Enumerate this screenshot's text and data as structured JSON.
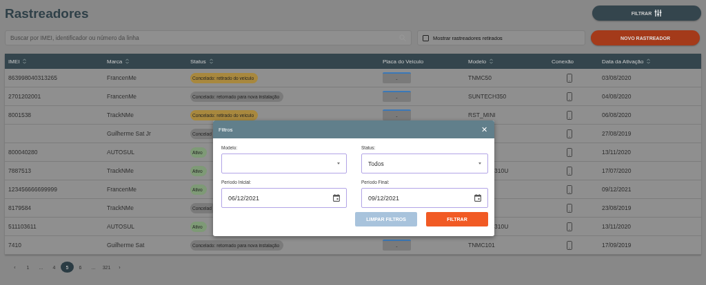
{
  "page": {
    "title": "Rastreadores"
  },
  "filter_button": {
    "label": "FILTRAR"
  },
  "search": {
    "placeholder": "Buscar por IMEI, identificador ou número da linha"
  },
  "show_retired": {
    "label": "Mostrar rastreadores retirados",
    "checked": false
  },
  "new_button": {
    "label": "NOVO RASTREADOR"
  },
  "table": {
    "columns": [
      {
        "label": "IMEI",
        "sortable": true
      },
      {
        "label": "Marca",
        "sortable": true
      },
      {
        "label": "Status",
        "sortable": true
      },
      {
        "label": "Placa do Veiculo",
        "sortable": false
      },
      {
        "label": "Modelo",
        "sortable": true
      },
      {
        "label": "Conexão",
        "sortable": false
      },
      {
        "label": "Data da Ativação",
        "sortable": true
      }
    ],
    "rows": [
      {
        "imei": "863998040313265",
        "marca": "FrancenMe",
        "status": {
          "text": "Concelado: retirado do veiculo",
          "color": "#a8883e"
        },
        "placa": "-",
        "modelo": {
          "text": "TNMC50"
        },
        "data": "03/08/2020"
      },
      {
        "imei": "2701202001",
        "marca": "FrancenMe",
        "status": {
          "text": "Concelado: retornado para nova instalação",
          "color": "#7a7a7a"
        },
        "placa": "-",
        "modelo": {
          "text": "SUNTECH350"
        },
        "data": "04/08/2020"
      },
      {
        "imei": "8001538",
        "marca": "TrackNMe",
        "status": {
          "text": "Concelado: retirado do veiculo",
          "color": "#a8883e"
        },
        "placa": "-",
        "modelo": {
          "text": "RST_MINI"
        },
        "data": "06/08/2020"
      },
      {
        "marca": "Guilherme Sat Jr",
        "status": {
          "text": "Concelad",
          "color": "#7a7a7a"
        },
        "data": "27/08/2019"
      },
      {
        "imei": "800040280",
        "marca": "AUTOSUL",
        "status": {
          "text": "Ativo",
          "color": "#7e9a76"
        },
        "data": "13/11/2020"
      },
      {
        "imei": "7887513",
        "marca": "TrackNMe",
        "status": {
          "text": "Ativo",
          "color": "#7e9a76"
        },
        "modelo": {
          "text": "310U",
          "cut": true
        },
        "data": "17/07/2020"
      },
      {
        "imei": "123456666699999",
        "marca": "FrancenMe",
        "status": {
          "text": "Ativo",
          "color": "#7e9a76"
        },
        "data": "09/12/2021"
      },
      {
        "imei": "8179584",
        "marca": "TrackNMe",
        "status": {
          "text": "Concelad",
          "color": "#7a7a7a"
        },
        "data": "23/08/2019"
      },
      {
        "imei": "511103611",
        "marca": "AUTOSUL",
        "status": {
          "text": "Ativo",
          "color": "#7e9a76"
        },
        "modelo": {
          "text": "310U",
          "cut": true
        },
        "data": "13/11/2020"
      },
      {
        "imei": "7410",
        "marca": "Guilherme Sat",
        "status": {
          "text": "Concelado: retornado para nova instalação",
          "color": "#7a7a7a"
        },
        "placa": "-",
        "modelo": {
          "text": "TNMC101"
        },
        "data": "17/09/2019"
      }
    ]
  },
  "pagination": [
    {
      "label": "‹",
      "selected": false
    },
    {
      "label": "1",
      "selected": false
    },
    {
      "label": "...",
      "selected": false
    },
    {
      "label": "4",
      "selected": false
    },
    {
      "label": "5",
      "selected": true
    },
    {
      "label": "6",
      "selected": false
    },
    {
      "label": "...",
      "selected": false
    },
    {
      "label": "321",
      "selected": false
    },
    {
      "label": "›",
      "selected": false
    }
  ],
  "modal": {
    "title": "Filtros",
    "close": "✕",
    "fields": [
      {
        "label": "Modelo:",
        "kind": "select"
      },
      {
        "label": "Status:",
        "kind": "select",
        "value": "Todos"
      },
      {
        "label": "Período Inicial:",
        "kind": "date",
        "value": "06/12/2021"
      },
      {
        "label": "Período Final:",
        "kind": "date",
        "value": "09/12/2021"
      }
    ],
    "buttons": [
      {
        "label": "LIMPAR FILTROS",
        "kind": "secondary"
      },
      {
        "label": "FILTRAR",
        "kind": "primary"
      }
    ]
  }
}
